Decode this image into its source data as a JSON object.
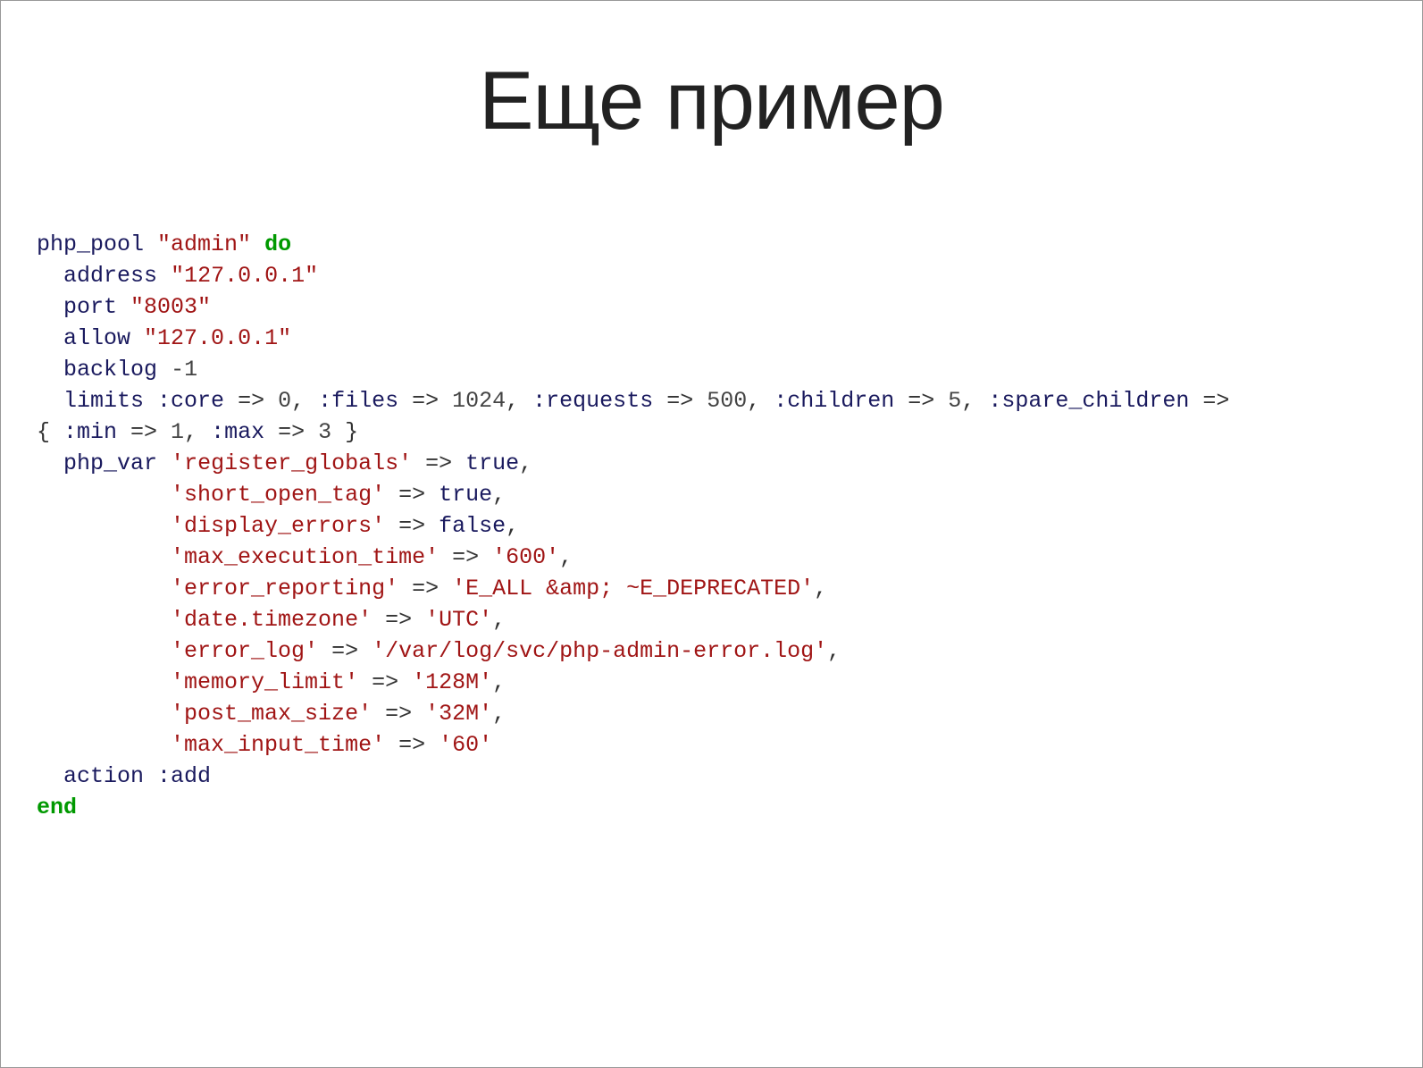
{
  "title": "Еще пример",
  "code": {
    "fn_php_pool": "php_pool",
    "pool_name": "\"admin\"",
    "kw_do": "do",
    "fn_address": "address",
    "val_address": "\"127.0.0.1\"",
    "fn_port": "port",
    "val_port": "\"8003\"",
    "fn_allow": "allow",
    "val_allow": "\"127.0.0.1\"",
    "fn_backlog": "backlog",
    "val_backlog": "-1",
    "fn_limits": "limits",
    "sym_core": ":core",
    "val_core": "0",
    "sym_files": ":files",
    "val_files": "1024",
    "sym_requests": ":requests",
    "val_requests": "500",
    "sym_children": ":children",
    "val_children": "5",
    "sym_spare_children": ":spare_children",
    "sym_min": ":min",
    "val_min": "1",
    "sym_max": ":max",
    "val_max": "3",
    "fn_php_var": "php_var",
    "str_register_globals": "'register_globals'",
    "val_true1": "true",
    "str_short_open_tag": "'short_open_tag'",
    "val_true2": "true",
    "str_display_errors": "'display_errors'",
    "val_false": "false",
    "str_max_exec": "'max_execution_time'",
    "val_max_exec": "'600'",
    "str_error_reporting": "'error_reporting'",
    "val_error_reporting": "'E_ALL &amp; ~E_DEPRECATED'",
    "str_date_tz": "'date.timezone'",
    "val_date_tz": "'UTC'",
    "str_error_log": "'error_log'",
    "val_error_log": "'/var/log/svc/php-admin-error.log'",
    "str_memory_limit": "'memory_limit'",
    "val_memory_limit": "'128M'",
    "str_post_max_size": "'post_max_size'",
    "val_post_max_size": "'32M'",
    "str_max_input_time": "'max_input_time'",
    "val_max_input_time": "'60'",
    "fn_action": "action",
    "sym_add": ":add",
    "kw_end": "end",
    "arrow": " => ",
    "comma": ", ",
    "brace_open": "{ ",
    "brace_close": " }"
  }
}
